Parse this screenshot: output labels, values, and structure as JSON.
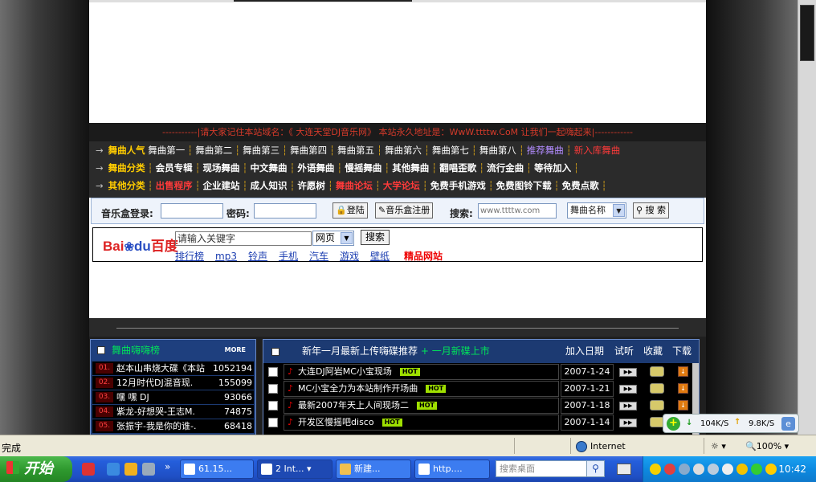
{
  "notice": "-----------|请大家记住本站域名：《 大连天堂DJ音乐网》 本站永久地址是：WwW.ttttw.CoM 让我们一起嗨起来|------------",
  "nav": {
    "row1": {
      "cat": "舞曲人气",
      "items": [
        "舞曲第一",
        "舞曲第二",
        "舞曲第三",
        "舞曲第四",
        "舞曲第五",
        "舞曲第六",
        "舞曲第七",
        "舞曲第八"
      ],
      "purple": "推荐舞曲",
      "red": "新入库舞曲"
    },
    "row2": {
      "cat": "舞曲分类",
      "items": [
        "会员专辑",
        "现场舞曲",
        "中文舞曲",
        "外语舞曲",
        "慢摇舞曲",
        "其他舞曲",
        "翻唱歪歌",
        "流行金曲",
        "等待加入"
      ]
    },
    "row3": {
      "cat": "其他分类",
      "items": [
        {
          "t": "出售程序",
          "c": "red"
        },
        {
          "t": "企业建站",
          "c": "white"
        },
        {
          "t": "成人知识",
          "c": "white"
        },
        {
          "t": "许愿树",
          "c": "white"
        },
        {
          "t": "舞曲论坛",
          "c": "red"
        },
        {
          "t": "大学论坛",
          "c": "red"
        },
        {
          "t": "免费手机游戏",
          "c": "white"
        },
        {
          "t": "免费图铃下载",
          "c": "white"
        },
        {
          "t": "免费点歌",
          "c": "white"
        }
      ]
    }
  },
  "login": {
    "label": "音乐盒登录:",
    "password_label": "密码:",
    "login_btn": "登陆",
    "register_btn": "音乐盒注册",
    "search_label": "搜索:",
    "search_placeholder": "www.ttttw.com",
    "search_field": "舞曲名称",
    "search_btn": "搜 索"
  },
  "baidu": {
    "logo_a": "Bai",
    "logo_paw": "❀",
    "logo_b": "du",
    "logo_cn": "百度",
    "query": "请输入关键字",
    "scope": "网页",
    "search_btn": "搜索",
    "links": [
      "排行榜",
      "mp3",
      "铃声",
      "手机",
      "汽车",
      "游戏",
      "壁纸"
    ],
    "hot_link": "精品网站"
  },
  "left_panel": {
    "title": "舞曲嗨嗨榜",
    "more": "MORE",
    "rows": [
      {
        "num": "01.",
        "title": "赵本山串烧大碟《本站",
        "count": "1052194"
      },
      {
        "num": "02.",
        "title": "12月时代DJ混音现.",
        "count": "155099"
      },
      {
        "num": "03.",
        "title": "嘿 嘿  DJ",
        "count": "93066"
      },
      {
        "num": "04.",
        "title": "紫龙-好想哭-王志M.",
        "count": "74875"
      },
      {
        "num": "05.",
        "title": "张振宇-我是你的谁-.",
        "count": "68418"
      }
    ]
  },
  "right_panel": {
    "title": "新年一月最新上传嗨碟推荐",
    "title_green": "+ 一月新碟上市",
    "col_date": "加入日期",
    "col_listen": "试听",
    "col_fav": "收藏",
    "col_dl": "下载",
    "hot": "HOT",
    "play_icon": "▶▶",
    "dl_icon": "↓",
    "rows": [
      {
        "title": "大连DJ阿岩MC小宝现场",
        "date": "2007-1-24"
      },
      {
        "title": "MC小宝全力为本站制作开场曲",
        "date": "2007-1-21"
      },
      {
        "title": "最新2007年天上人间现场二",
        "date": "2007-1-18"
      },
      {
        "title": "开发区慢摇吧disco",
        "date": "2007-1-14"
      }
    ]
  },
  "netmon": {
    "plus": "+",
    "down_arrow": "↓",
    "down": "104K/S",
    "up_arrow": "↑",
    "up": "9.8K/S",
    "ie": "e"
  },
  "status": {
    "done": "完成",
    "zone": "Internet",
    "zoom_icon": "☼ ▾",
    "zoom": "🔍100%  ▾"
  },
  "taskbar": {
    "start": "开始",
    "more": "»",
    "tasks": [
      "61.15...",
      "2 Int...",
      "新建...",
      "http...."
    ],
    "search_placeholder": "搜索桌面",
    "search_icon": "⚲",
    "clock": "10:42"
  },
  "colors": {
    "accent_red": "#d43a2a",
    "nav_yellow": "#ffcc00",
    "panel_blue": "#1c3a72",
    "hot_green": "#00e35a"
  }
}
